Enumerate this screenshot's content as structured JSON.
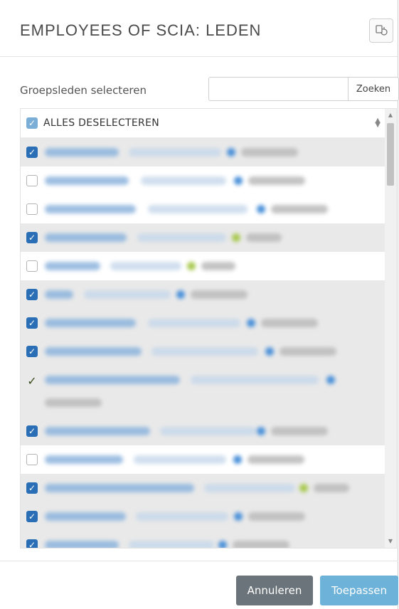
{
  "dialog": {
    "title": "EMPLOYEES OF SCIA: LEDEN",
    "refresh_icon": "refresh-icon"
  },
  "filter": {
    "label": "Groepsleden selecteren",
    "search_value": "",
    "search_button": "Zoeken"
  },
  "list": {
    "header_label": "ALLES DESELECTEREN",
    "header_checked": true,
    "rows": [
      {
        "state": "checked"
      },
      {
        "state": "unchecked"
      },
      {
        "state": "unchecked"
      },
      {
        "state": "checked"
      },
      {
        "state": "unchecked"
      },
      {
        "state": "checked"
      },
      {
        "state": "checked"
      },
      {
        "state": "checked"
      },
      {
        "state": "tick"
      },
      {
        "state": "checked"
      },
      {
        "state": "unchecked"
      },
      {
        "state": "checked"
      },
      {
        "state": "checked"
      },
      {
        "state": "checked"
      }
    ]
  },
  "footer": {
    "cancel_label": "Annuleren",
    "apply_label": "Toepassen"
  },
  "colors": {
    "checkbox_checked": "#2a6fb6",
    "cancel_button": "#6b747a",
    "apply_button": "#6db2d8"
  }
}
